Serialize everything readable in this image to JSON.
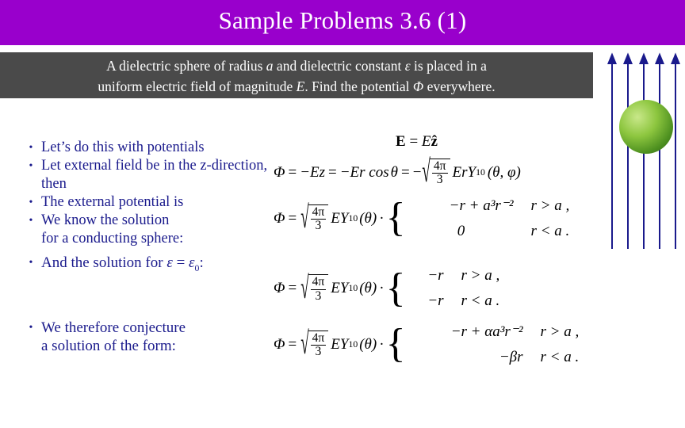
{
  "slide": {
    "title": "Sample Problems 3.6 (1)",
    "title_bar_color": "#9900cc",
    "statement_bg_color": "#4a4a4a",
    "bullet_color": "#1a1a8c"
  },
  "statement": {
    "line1_a": "A dielectric sphere of radius ",
    "line1_a_italic": "a",
    "line1_b": " and dielectric constant ",
    "line1_b_italic": "ε",
    "line1_c": " is placed in a",
    "line2_a": "uniform electric field of magnitude ",
    "line2_a_italic": "E",
    "line2_b": ".  Find the potential ",
    "line2_b_italic": "Φ",
    "line2_c": " everywhere."
  },
  "bullets_1": {
    "mark": "•",
    "items": [
      "Let’s do this with potentials",
      "Let external field be in the z-direction, then",
      "The external potential is",
      "We know the solution"
    ],
    "continuation": "for a conducting sphere:"
  },
  "bullets_2": {
    "mark": "•",
    "text_a": "And the solution for ",
    "text_eps": "ε",
    "text_b": " = ",
    "text_eps0": "ε",
    "text_sub0": "0",
    "text_c": ":"
  },
  "bullets_3": {
    "mark": "•",
    "line1": "We therefore conjecture",
    "line2": "a solution of the form:"
  },
  "math": {
    "field_eq": {
      "lhs": "E",
      "eq": "=",
      "rhs": "E",
      "unit_vector": "ẑ"
    },
    "potential_eq": {
      "phi": "Φ",
      "eq": "=",
      "term1": "−Ez",
      "eq2": "=",
      "term2": "−Er cos",
      "theta": "θ",
      "eq3": "=",
      "minus": "−",
      "sqrt_num": "4π",
      "sqrt_den": "3",
      "ErY": "ErY",
      "Y_sub": "10",
      "args": "(θ, φ)"
    },
    "cond_sphere": {
      "phi": "Φ",
      "eq": "=",
      "sqrt_num": "4π",
      "sqrt_den": "3",
      "EY": "EY",
      "Y_sub": "10",
      "theta_arg": "(θ)",
      "dot": "·",
      "case1_val": "−r + a³r⁻²",
      "case1_cond": "r > a ,",
      "case2_val": "0",
      "case2_cond": "r < a ."
    },
    "eps0_case": {
      "phi": "Φ",
      "eq": "=",
      "sqrt_num": "4π",
      "sqrt_den": "3",
      "EY": "EY",
      "Y_sub": "10",
      "theta_arg": "(θ)",
      "dot": "·",
      "case1_val": "−r",
      "case1_cond": "r > a ,",
      "case2_val": "−r",
      "case2_cond": "r < a ."
    },
    "conjecture": {
      "phi": "Φ",
      "eq": "=",
      "sqrt_num": "4π",
      "sqrt_den": "3",
      "EY": "EY",
      "Y_sub": "10",
      "theta_arg": "(θ)",
      "dot": "·",
      "case1_val": "−r + αa³r⁻²",
      "case1_cond": "r > a ,",
      "case2_val": "−βr",
      "case2_cond": "r < a ."
    }
  },
  "figure": {
    "sphere_label": "dielectric-sphere",
    "arrow_count": 5,
    "arrow_color": "#1a1a8c"
  }
}
